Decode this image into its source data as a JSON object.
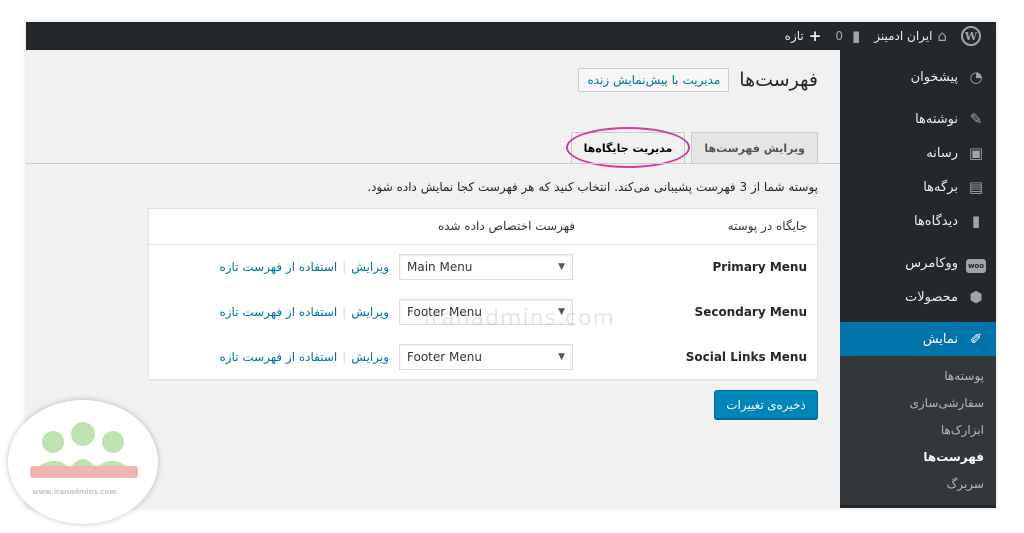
{
  "adminbar": {
    "site_name": "ایران ادمینز",
    "comments_count": "0",
    "new_label": "تازه"
  },
  "sidebar": {
    "items": [
      {
        "label": "پیشخوان",
        "icon": "dashboard-icon"
      },
      {
        "label": "نوشته‌ها",
        "icon": "pin-icon"
      },
      {
        "label": "رسانه",
        "icon": "media-icon"
      },
      {
        "label": "برگه‌ها",
        "icon": "pages-icon"
      },
      {
        "label": "دیدگاه‌ها",
        "icon": "comment-icon"
      },
      {
        "label": "ووکامرس",
        "icon": "woocommerce-icon"
      },
      {
        "label": "محصولات",
        "icon": "products-icon"
      },
      {
        "label": "نمایش",
        "icon": "appearance-icon"
      }
    ],
    "submenu": [
      {
        "label": "پوسته‌ها"
      },
      {
        "label": "سفارشی‌سازی"
      },
      {
        "label": "ابزارک‌ها"
      },
      {
        "label": "فهرست‌ها"
      },
      {
        "label": "سربرگ"
      }
    ],
    "woo_badge": "woo"
  },
  "page": {
    "title": "فهرست‌ها",
    "title_action": "مدیریت با پیش‌نمایش زنده",
    "tabs": [
      {
        "label": "ویرایش فهرست‌ها"
      },
      {
        "label": "مدیریت جایگاه‌ها"
      }
    ],
    "description": "پوسته شما از 3 فهرست پشیبانی می‌کند. انتخاب کنید که هر فهرست کجا نمایش داده شود.",
    "table": {
      "col_location": "جایگاه در پوسته",
      "col_assigned": "فهرست اختصاص داده شده",
      "rows": [
        {
          "location": "Primary Menu",
          "menu": "Main Menu",
          "edit": "ویرایش",
          "use_new": "استفاده از فهرست تازه"
        },
        {
          "location": "Secondary Menu",
          "menu": "Footer Menu",
          "edit": "ویرایش",
          "use_new": "استفاده از فهرست تازه"
        },
        {
          "location": "Social Links Menu",
          "menu": "Footer Menu",
          "edit": "ویرایش",
          "use_new": "استفاده از فهرست تازه"
        }
      ]
    },
    "save_label": "ذخیره‌ی تغییرات"
  },
  "watermark": "iranadmins.com",
  "logo_url": "www.iranadmins.com",
  "colors": {
    "adminbar": "#23282d",
    "accent": "#0073aa",
    "primary_button": "#0085ba",
    "highlight_ring": "#d63aa2"
  }
}
